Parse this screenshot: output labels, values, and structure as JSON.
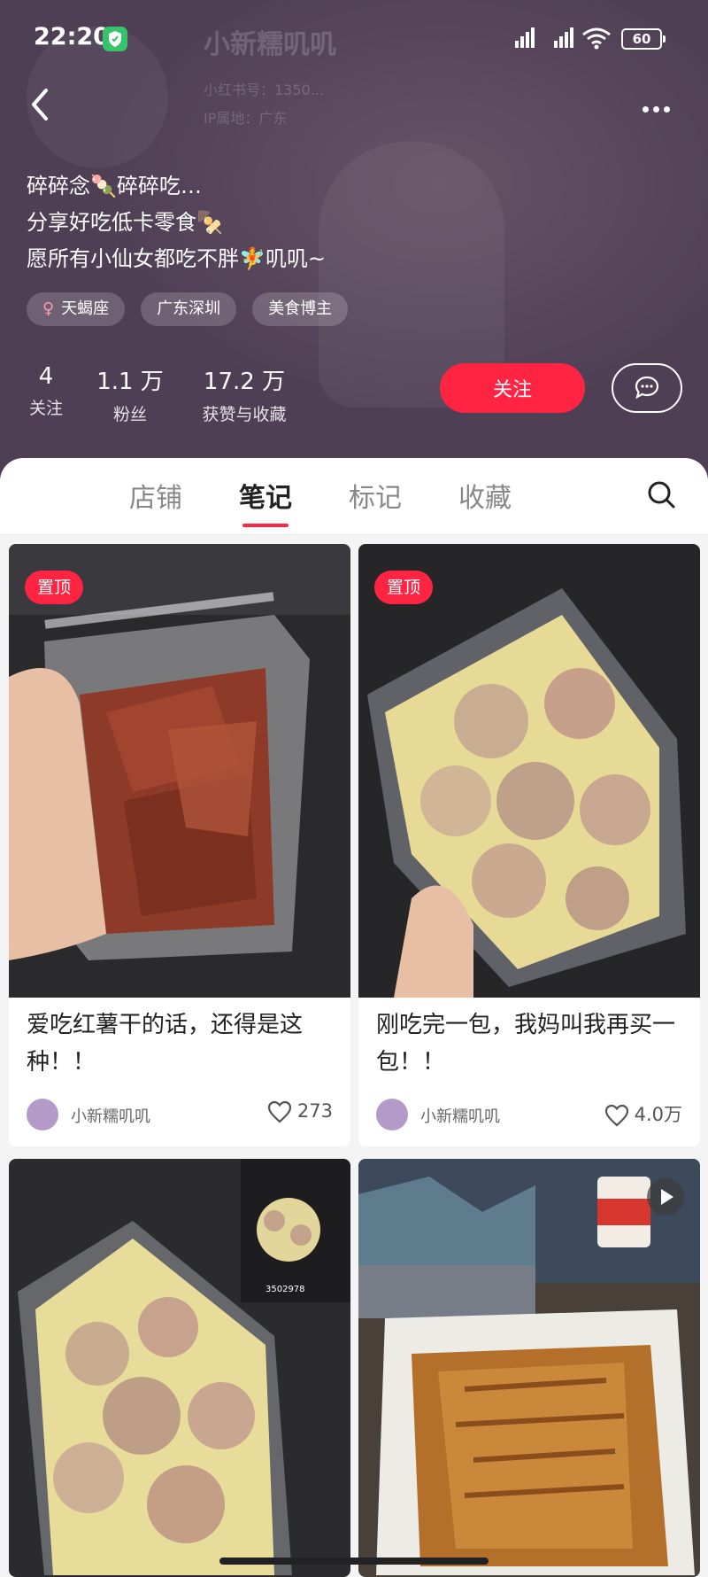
{
  "status": {
    "time": "22:20",
    "battery": "60"
  },
  "profile": {
    "ghost_name": "小新糯叽叽",
    "ghost_id": "小红书号：1350...",
    "ghost_ip": "IP属地：广东",
    "bio": [
      "碎碎念🍡碎碎吃…",
      "分享好吃低卡零食🍢",
      "愿所有小仙女都吃不胖🧚叽叽~"
    ],
    "tags": [
      {
        "label": "天蝎座",
        "icon": "female-icon"
      },
      {
        "label": "广东深圳"
      },
      {
        "label": "美食博主"
      }
    ],
    "stats": [
      {
        "value": "4",
        "label": "关注"
      },
      {
        "value": "1.1 万",
        "label": "粉丝"
      },
      {
        "value": "17.2 万",
        "label": "获赞与收藏"
      }
    ],
    "follow_label": "关注"
  },
  "tabs": [
    {
      "label": "店铺",
      "active": false
    },
    {
      "label": "笔记",
      "active": true
    },
    {
      "label": "标记",
      "active": false
    },
    {
      "label": "收藏",
      "active": false
    }
  ],
  "notes": [
    {
      "pinned": "置顶",
      "title": "爱吃红薯干的话，还得是这种！！",
      "author": "小新糯叽叽",
      "likes": "273"
    },
    {
      "pinned": "置顶",
      "title": "刚吃完一包，我妈叫我再买一包！！",
      "author": "小新糯叽叽",
      "likes": "4.0万"
    },
    {
      "views": "3502978"
    },
    {
      "video": true
    }
  ],
  "colors": {
    "accent": "#ff2442",
    "header_bg": "#4f3f55"
  }
}
